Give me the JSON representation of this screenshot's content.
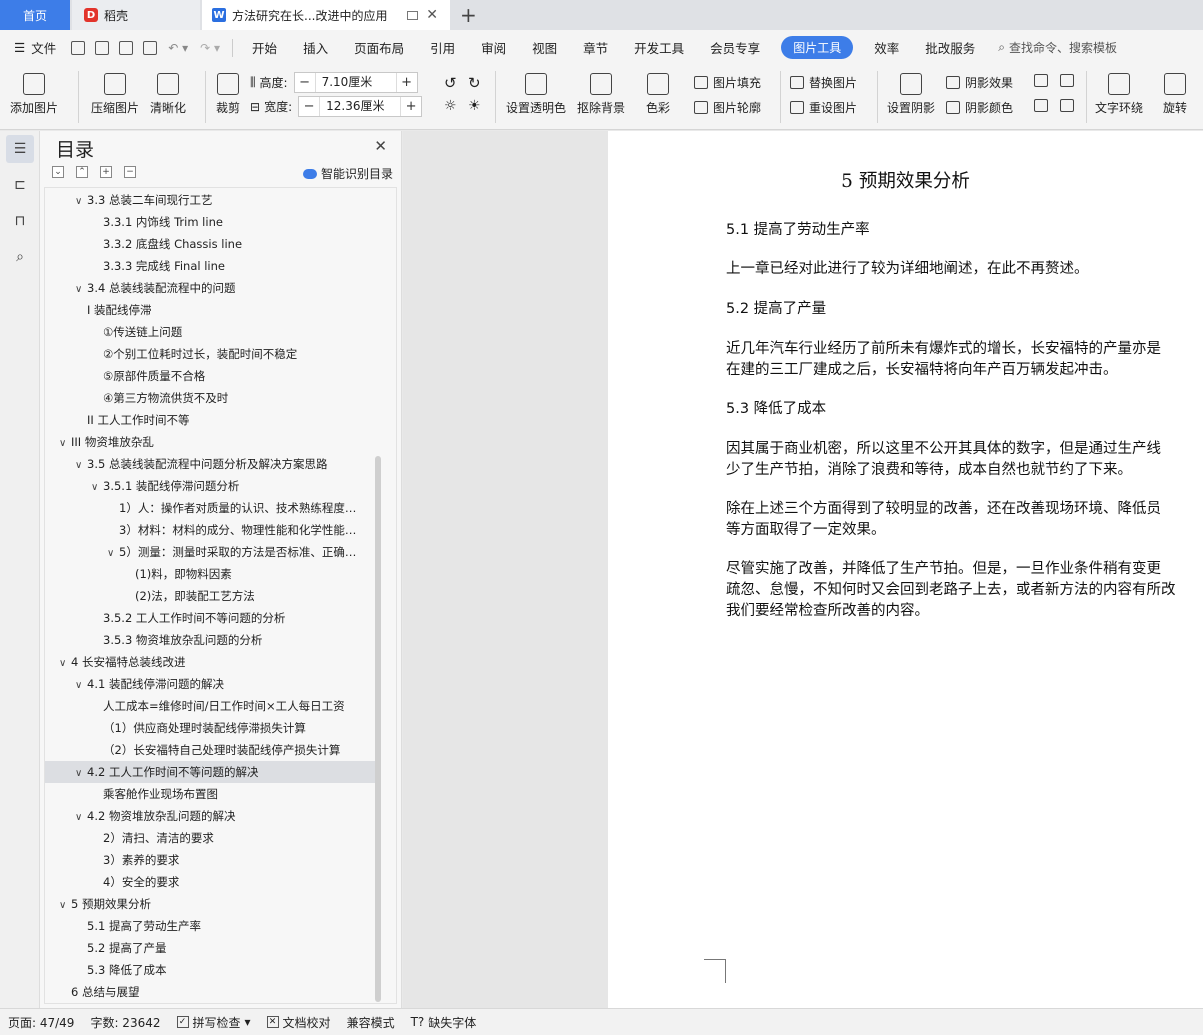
{
  "tabs": {
    "home": "首页",
    "daoke": "稻壳",
    "doc": "方法研究在长...改进中的应用",
    "new": "+"
  },
  "menu": {
    "file": "文件",
    "items": [
      "开始",
      "插入",
      "页面布局",
      "引用",
      "审阅",
      "视图",
      "章节",
      "开发工具",
      "会员专享"
    ],
    "active": "图片工具",
    "after": [
      "效率",
      "批改服务"
    ],
    "search": "查找命令、搜索模板"
  },
  "ribbon": {
    "add_image": "添加图片",
    "compress": "压缩图片",
    "sharpen": "清晰化",
    "crop": "裁剪",
    "height_label": "高度:",
    "height_value": "7.10厘米",
    "width_label": "宽度:",
    "width_value": "12.36厘米",
    "transparent": "设置透明色",
    "remove_bg": "抠除背景",
    "color": "色彩",
    "fill": "图片填充",
    "outline": "图片轮廓",
    "replace": "替换图片",
    "reset": "重设图片",
    "shadow": "设置阴影",
    "shadow_effect": "阴影效果",
    "shadow_color": "阴影颜色",
    "wrap": "文字环绕",
    "rotate": "旋转"
  },
  "toc": {
    "title": "目录",
    "smart": "智能识别目录",
    "items": [
      {
        "text": "3.3 总装二车间现行工艺",
        "caret": "v"
      },
      {
        "text": "3.3.1 内饰线  Trim line",
        "caret": ""
      },
      {
        "text": "3.3.2 底盘线  Chassis line",
        "caret": ""
      },
      {
        "text": "3.3.3 完成线  Final line",
        "caret": ""
      },
      {
        "text": "3.4 总装线装配流程中的问题",
        "caret": "v"
      },
      {
        "text": "I 装配线停滞",
        "caret": ""
      },
      {
        "text": "①传送链上问题",
        "caret": ""
      },
      {
        "text": "②个别工位耗时过长，装配时间不稳定",
        "caret": ""
      },
      {
        "text": "⑤原部件质量不合格",
        "caret": ""
      },
      {
        "text": "④第三方物流供货不及时",
        "caret": ""
      },
      {
        "text": "II 工人工作时间不等",
        "caret": ""
      },
      {
        "text": "III 物资堆放杂乱",
        "caret": "v"
      },
      {
        "text": "3.5 总装线装配流程中问题分析及解决方案思路",
        "caret": "v"
      },
      {
        "text": "3.5.1 装配线停滞问题分析",
        "caret": "v"
      },
      {
        "text": "1）人：操作者对质量的认识、技术熟练程度…",
        "caret": ""
      },
      {
        "text": "3）材料：材料的成分、物理性能和化学性能…",
        "caret": ""
      },
      {
        "text": "5）测量：测量时采取的方法是否标准、正确…",
        "caret": "v"
      },
      {
        "text": "(1)料，即物料因素",
        "caret": ""
      },
      {
        "text": "(2)法，即装配工艺方法",
        "caret": ""
      },
      {
        "text": "3.5.2 工人工作时间不等问题的分析",
        "caret": ""
      },
      {
        "text": "3.5.3 物资堆放杂乱问题的分析",
        "caret": ""
      },
      {
        "text": "4  长安福特总装线改进",
        "caret": "v"
      },
      {
        "text": "4.1 装配线停滞问题的解决",
        "caret": "v"
      },
      {
        "text": "人工成本=维修时间/日工作时间×工人每日工资",
        "caret": ""
      },
      {
        "text": "（1）供应商处理时装配线停滞损失计算",
        "caret": ""
      },
      {
        "text": "（2）长安福特自己处理时装配线停产损失计算",
        "caret": ""
      },
      {
        "text": "4.2 工人工作时间不等问题的解决",
        "caret": "v"
      },
      {
        "text": "乘客舱作业现场布置图",
        "caret": ""
      },
      {
        "text": "4.2 物资堆放杂乱问题的解决",
        "caret": "v"
      },
      {
        "text": "2）清扫、清洁的要求",
        "caret": ""
      },
      {
        "text": "3）素养的要求",
        "caret": ""
      },
      {
        "text": "4）安全的要求",
        "caret": ""
      },
      {
        "text": "5  预期效果分析",
        "caret": "v"
      },
      {
        "text": "5.1 提高了劳动生产率",
        "caret": ""
      },
      {
        "text": "5.2 提高了产量",
        "caret": ""
      },
      {
        "text": "5.3 降低了成本",
        "caret": ""
      },
      {
        "text": "6  总结与展望",
        "caret": ""
      }
    ]
  },
  "doc": {
    "chapter_title": "5  预期效果分析",
    "paragraphs": [
      "5.1 提高了劳动生产率",
      "上一章已经对此进行了较为详细地阐述，在此不再赘述。",
      "5.2 提高了产量",
      "近几年汽车行业经历了前所未有爆炸式的增长，长安福特的产量亦是",
      "在建的三工厂建成之后，长安福特将向年产百万辆发起冲击。",
      "5.3 降低了成本",
      "因其属于商业机密，所以这里不公开其具体的数字，但是通过生产线",
      "少了生产节拍，消除了浪费和等待，成本自然也就节约了下来。",
      "除在上述三个方面得到了较明显的改善，还在改善现场环境、降低员",
      "等方面取得了一定效果。",
      "尽管实施了改善，并降低了生产节拍。但是，一旦作业条件稍有变更",
      "疏忽、怠慢，不知何时又会回到老路子上去，或者新方法的内容有所改",
      "我们要经常检查所改善的内容。"
    ]
  },
  "status": {
    "page": "页面: 47/49",
    "words": "字数: 23642",
    "spell": "拼写检查",
    "proof": "文档校对",
    "compat": "兼容模式",
    "font": "缺失字体"
  }
}
